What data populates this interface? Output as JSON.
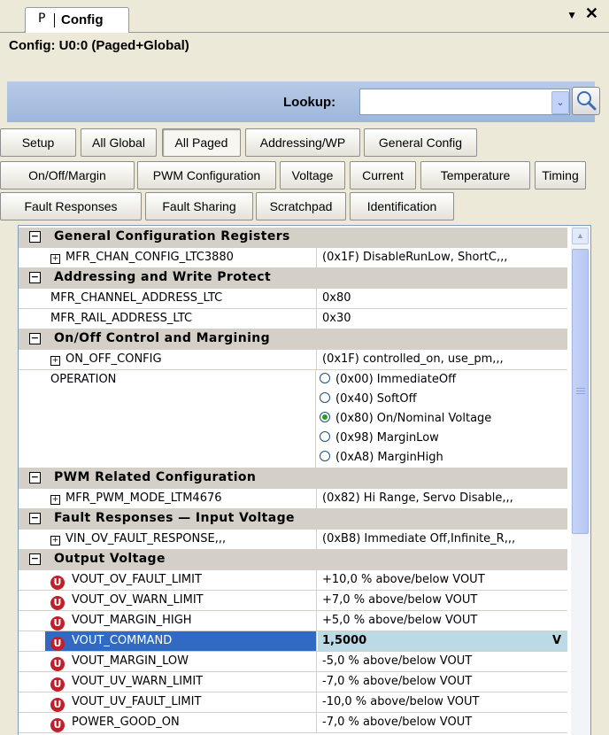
{
  "panel": {
    "tab_icon": "P",
    "tab_label": "Config",
    "menu_glyph": "▼",
    "close_glyph": "✕",
    "title": "Config: U0:0 (Paged+Global)"
  },
  "lookup": {
    "label": "Lookup:",
    "value": "",
    "dropdown_glyph": "⌄"
  },
  "section_buttons": [
    [
      "Setup",
      "All Global",
      "All Paged",
      "Addressing/WP",
      "General Config"
    ],
    [
      "On/Off/Margin",
      "PWM Configuration",
      "Voltage",
      "Current",
      "Temperature",
      "Timing"
    ],
    [
      "Fault Responses",
      "Fault Sharing",
      "Scratchpad",
      "Identification"
    ]
  ],
  "active_button": "All Paged",
  "grid": {
    "categories": [
      {
        "name": "General Configuration Registers",
        "rows": [
          {
            "name": "MFR_CHAN_CONFIG_LTC3880",
            "value": "(0x1F)  DisableRunLow, ShortC,,,",
            "expandable": true
          }
        ]
      },
      {
        "name": "Addressing and Write Protect",
        "rows": [
          {
            "name": "MFR_CHANNEL_ADDRESS_LTC",
            "value": "0x80"
          },
          {
            "name": "MFR_RAIL_ADDRESS_LTC",
            "value": "0x30"
          }
        ]
      },
      {
        "name": "On/Off Control and Margining",
        "rows": [
          {
            "name": "ON_OFF_CONFIG",
            "value": "(0x1F)  controlled_on, use_pm,,,",
            "expandable": true
          }
        ],
        "operation": {
          "name": "OPERATION",
          "options": [
            "(0x00) ImmediateOff",
            "(0x40) SoftOff",
            "(0x80) On/Nominal Voltage",
            "(0x98) MarginLow",
            "(0xA8) MarginHigh"
          ],
          "selected": 2
        }
      },
      {
        "name": "PWM Related Configuration",
        "rows": [
          {
            "name": "MFR_PWM_MODE_LTM4676",
            "value": "(0x82) Hi Range, Servo Disable,,,",
            "expandable": true
          }
        ]
      },
      {
        "name": "Fault Responses — Input Voltage",
        "rows": [
          {
            "name": "VIN_OV_FAULT_RESPONSE,,,",
            "value": "(0xB8) Immediate Off,Infinite_R,,,",
            "expandable": true
          }
        ]
      },
      {
        "name": "Output Voltage",
        "rows": [
          {
            "name": "VOUT_OV_FAULT_LIMIT",
            "value": "+10,0 % above/below VOUT",
            "icon": "U"
          },
          {
            "name": "VOUT_OV_WARN_LIMIT",
            "value": "+7,0 % above/below VOUT",
            "icon": "U"
          },
          {
            "name": "VOUT_MARGIN_HIGH",
            "value": "+5,0 % above/below VOUT",
            "icon": "U"
          },
          {
            "name": "VOUT_COMMAND",
            "value": "1,5000",
            "icon": "U",
            "selected": true,
            "edit_mark": "V"
          },
          {
            "name": "VOUT_MARGIN_LOW",
            "value": "-5,0 % above/below VOUT",
            "icon": "U"
          },
          {
            "name": "VOUT_UV_WARN_LIMIT",
            "value": "-7,0 % above/below VOUT",
            "icon": "U"
          },
          {
            "name": "VOUT_UV_FAULT_LIMIT",
            "value": "-10,0 % above/below VOUT",
            "icon": "U"
          },
          {
            "name": "POWER_GOOD_ON",
            "value": "-7,0 % above/below VOUT",
            "icon": "U"
          }
        ]
      }
    ]
  },
  "icons": {
    "collapse": "⊟",
    "expand": "⊞",
    "search": "search-icon",
    "unit_badge": "u-badge-icon"
  },
  "colors": {
    "selection": "#316ac5",
    "selected_value_bg": "#bcd9e6",
    "badge": "#c0202c",
    "radio_on": "#21a121"
  }
}
